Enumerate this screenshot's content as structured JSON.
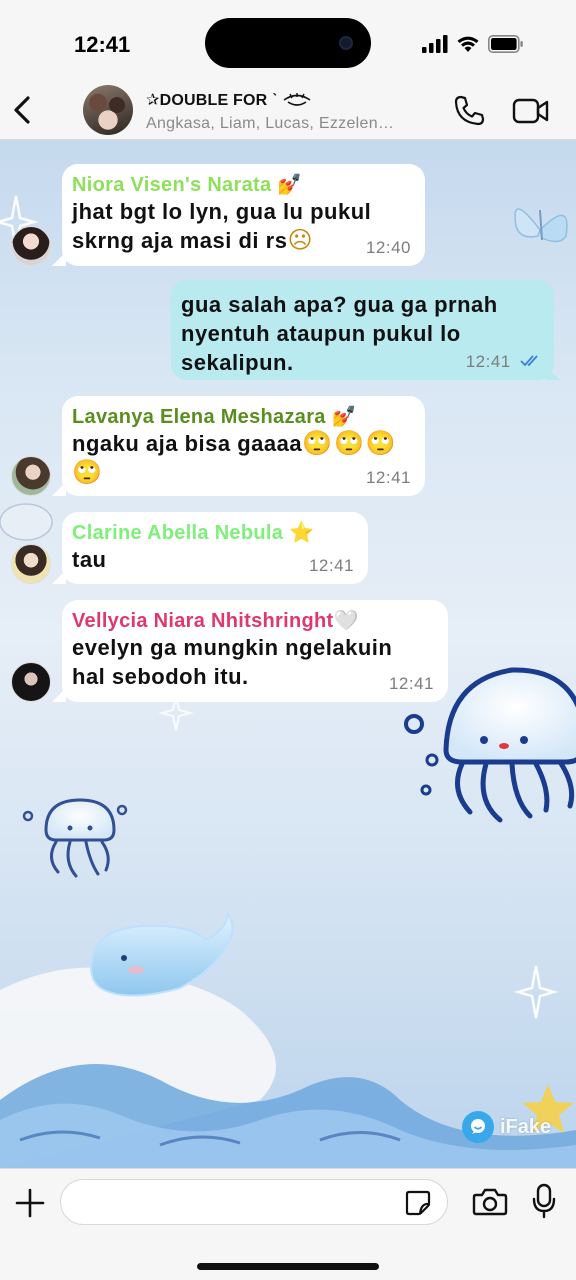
{
  "status_bar": {
    "time": "12:41"
  },
  "header": {
    "title": "✰DOUBLE FOR ˋ",
    "members": "Angkasa, Liam, Lucas, Ezzelen…"
  },
  "messages": [
    {
      "direction": "in",
      "sender": "Niora Visen's Narata",
      "sender_emoji": "💅",
      "sender_color": "#8ee05a",
      "text_lines": [
        "jhat bgt lo lyn, gua lu pukul",
        "skrng aja masi di rs"
      ],
      "text_emoji": "☹",
      "time": "12:40"
    },
    {
      "direction": "out",
      "text_lines": [
        "gua salah apa? gua ga prnah",
        "nyentuh ataupun pukul lo",
        "sekalipun."
      ],
      "time": "12:41",
      "status": "read-double-check"
    },
    {
      "direction": "in",
      "sender": "Lavanya Elena Meshazara",
      "sender_emoji": "💅",
      "sender_color": "#5a8e1e",
      "text_lines": [
        "ngaku aja bisa gaaaa"
      ],
      "text_emoji": "🙄🙄🙄🙄",
      "time": "12:41"
    },
    {
      "direction": "in",
      "sender": "Clarine Abella Nebula",
      "sender_emoji": "⭐",
      "sender_color": "#7ef07a",
      "text_lines": [
        "tau"
      ],
      "time": "12:41"
    },
    {
      "direction": "in",
      "sender": "Vellycia Niara Nhitshringht",
      "sender_emoji": "🤍",
      "sender_color": "#e0386c",
      "text_lines": [
        "evelyn ga mungkin ngelakuin",
        "hal sebodoh itu."
      ],
      "time": "12:41"
    }
  ],
  "input": {
    "placeholder": "",
    "value": ""
  },
  "watermark": {
    "label": "iFake"
  },
  "colors": {
    "outgoing_bubble": "#b8eaf0",
    "incoming_bubble": "#ffffff",
    "read_check": "#3b82d6"
  },
  "icons": [
    "back-chevron-icon",
    "phone-icon",
    "video-camera-icon",
    "plus-icon",
    "sticker-icon",
    "camera-icon",
    "microphone-icon",
    "signal-icon",
    "wifi-icon",
    "battery-icon"
  ]
}
